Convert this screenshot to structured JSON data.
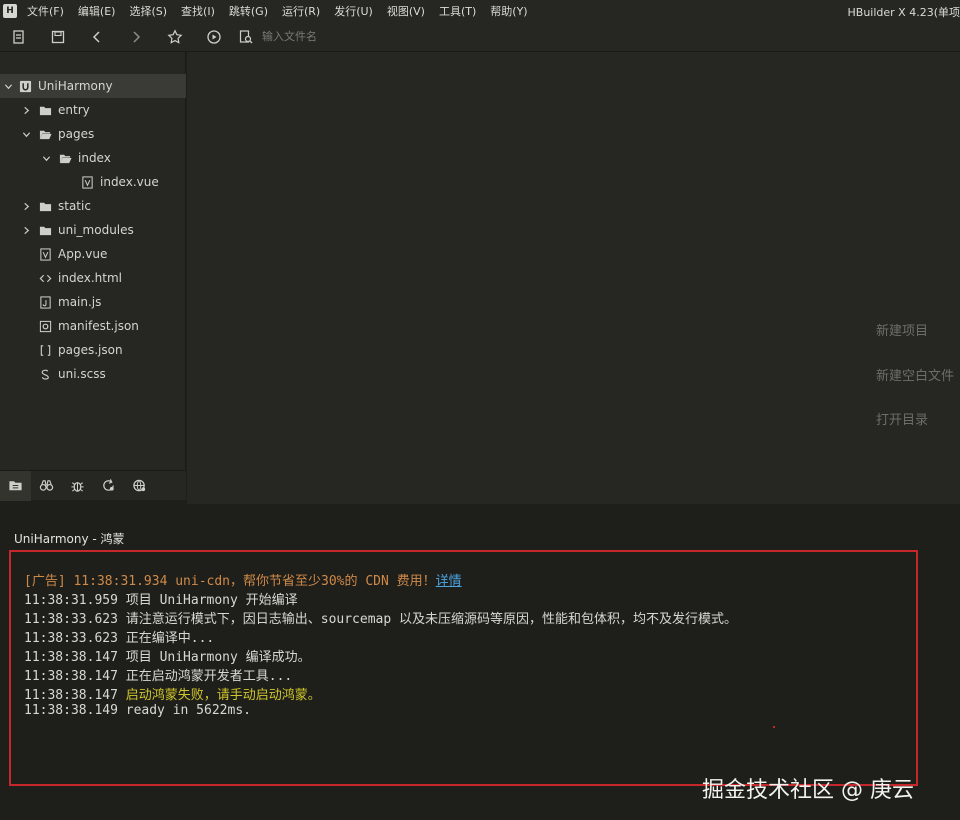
{
  "menubar": {
    "logo_text": "H",
    "items": [
      "文件(F)",
      "编辑(E)",
      "选择(S)",
      "查找(I)",
      "跳转(G)",
      "运行(R)",
      "发行(U)",
      "视图(V)",
      "工具(T)",
      "帮助(Y)"
    ],
    "window_title": "HBuilder X 4.23(单项"
  },
  "toolbar": {
    "file_search_placeholder": "输入文件名"
  },
  "sidebar": {
    "project_name": "UniHarmony",
    "tree": {
      "entry": "entry",
      "pages": "pages",
      "index": "index",
      "index_vue": "index.vue",
      "static": "static",
      "uni_modules": "uni_modules",
      "app_vue": "App.vue",
      "index_html": "index.html",
      "main_js": "main.js",
      "manifest_json": "manifest.json",
      "pages_json": "pages.json",
      "uni_scss": "uni.scss"
    }
  },
  "welcome": {
    "new_project": "新建项目",
    "new_blank_file": "新建空白文件",
    "open_directory": "打开目录"
  },
  "console": {
    "tab_title": "UniHarmony - 鸿蒙",
    "lines": {
      "l0_prefix": "[广告] 11:38:31.934 uni-cdn，帮你节省至少30%的 CDN 费用！",
      "l0_link": "详情",
      "l1": "11:38:31.959 项目 UniHarmony 开始编译",
      "l2": "11:38:33.623 请注意运行模式下，因日志输出、sourcemap 以及未压缩源码等原因，性能和包体积，均不及发行模式。",
      "l3": "11:38:33.623 正在编译中...",
      "l4": "11:38:38.147 项目 UniHarmony 编译成功。",
      "l5": "11:38:38.147 正在启动鸿蒙开发者工具...",
      "l6_time": "11:38:38.147 ",
      "l6_msg": "启动鸿蒙失败，请手动启动鸿蒙。",
      "l7": "11:38:38.149 ready in 5622ms."
    },
    "watermark": "掘金技术社区 @ 庚云"
  },
  "colors": {
    "highlight_border": "#c6272b",
    "ad_text": "#d08a47",
    "warning_text": "#d0c62b",
    "link": "#4aa3df"
  }
}
